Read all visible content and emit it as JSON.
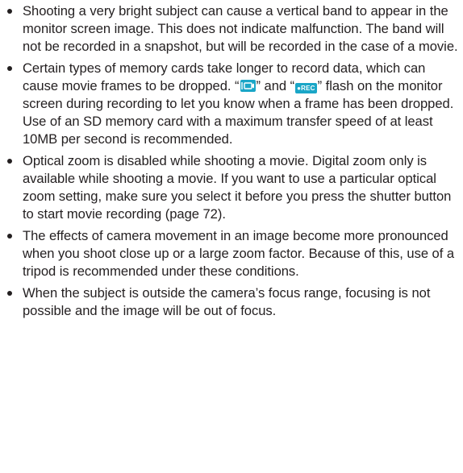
{
  "notes": [
    {
      "segments": [
        {
          "type": "text",
          "value": "Shooting a very bright subject can cause a vertical band to appear in the monitor screen image. This does not indicate malfunction. The band will not be recorded in a snapshot, but will be recorded in the case of a movie."
        }
      ]
    },
    {
      "segments": [
        {
          "type": "text",
          "value": "Certain types of memory cards take longer to record data, which can cause movie frames to be dropped. “"
        },
        {
          "type": "icon",
          "icon": "movie-camera-icon"
        },
        {
          "type": "text",
          "value": "” and “"
        },
        {
          "type": "icon",
          "icon": "rec-icon",
          "value": "●REC"
        },
        {
          "type": "text",
          "value": "” flash on the monitor screen during recording to let you know when a frame has been dropped. Use of an SD memory card with a maximum transfer speed of at least 10MB per second is recommended."
        }
      ]
    },
    {
      "segments": [
        {
          "type": "text",
          "value": "Optical zoom is disabled while shooting a movie. Digital zoom only is available while shooting a movie. If you want to use a particular optical zoom setting, make sure you select it before you press the shutter button to start movie recording (page 72)."
        }
      ]
    },
    {
      "segments": [
        {
          "type": "text",
          "value": "The effects of camera movement in an image become more pronounced when you shoot close up or a large zoom factor. Because of this, use of a tripod is recommended under these conditions."
        }
      ]
    },
    {
      "segments": [
        {
          "type": "text",
          "value": "When the subject is outside the camera’s focus range, focusing is not possible and the image will be out of focus."
        }
      ]
    }
  ],
  "icon_colors": {
    "badge_background": "#1aa6c7",
    "badge_foreground": "#ffffff"
  }
}
